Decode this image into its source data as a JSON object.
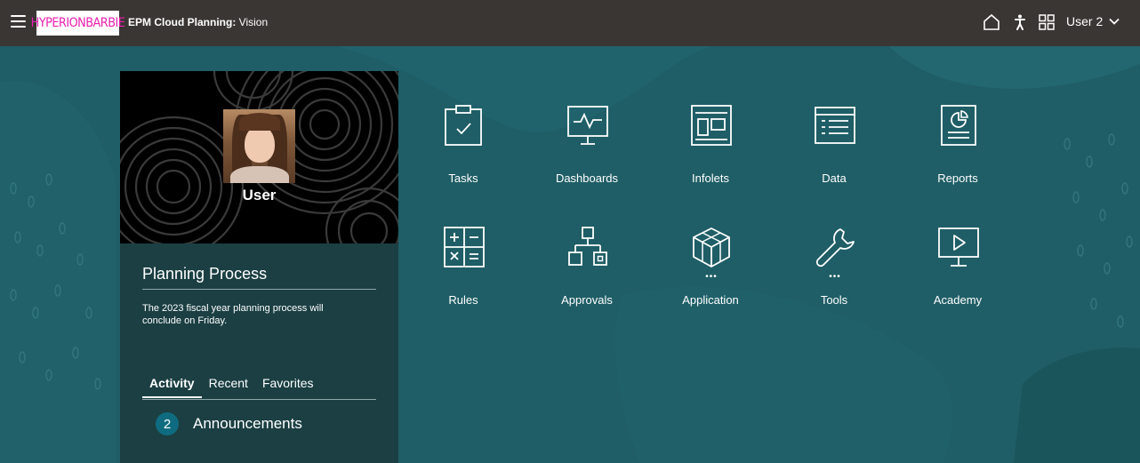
{
  "header": {
    "logo": "HYPERIONBARBIE",
    "app_name": "EPM Cloud Planning:",
    "app_suffix": "Vision",
    "user_label": "User 2",
    "icons": [
      "menu-icon",
      "home-icon",
      "accessibility-icon",
      "navigator-icon",
      "chevron-down-icon"
    ]
  },
  "panel": {
    "user_name": "User",
    "title": "Planning Process",
    "message": "The 2023 fiscal year planning process will conclude on Friday.",
    "tabs": [
      {
        "label": "Activity",
        "active": true
      },
      {
        "label": "Recent",
        "active": false
      },
      {
        "label": "Favorites",
        "active": false
      }
    ],
    "announcements": {
      "count": "2",
      "label": "Announcements"
    }
  },
  "tiles": [
    {
      "label": "Tasks",
      "icon": "tasks-icon"
    },
    {
      "label": "Dashboards",
      "icon": "dashboards-icon"
    },
    {
      "label": "Infolets",
      "icon": "infolets-icon"
    },
    {
      "label": "Data",
      "icon": "data-icon"
    },
    {
      "label": "Reports",
      "icon": "reports-icon"
    },
    {
      "label": "Rules",
      "icon": "rules-icon"
    },
    {
      "label": "Approvals",
      "icon": "approvals-icon"
    },
    {
      "label": "Application",
      "icon": "application-icon",
      "more": "•••"
    },
    {
      "label": "Tools",
      "icon": "tools-icon",
      "more": "•••"
    },
    {
      "label": "Academy",
      "icon": "academy-icon"
    }
  ],
  "colors": {
    "header_bg": "#3a3634",
    "page_bg": "#1f5e66",
    "panel_bg": "#1b3f43",
    "logo_text": "#e91fb0",
    "badge_bg": "#0f6c80"
  }
}
